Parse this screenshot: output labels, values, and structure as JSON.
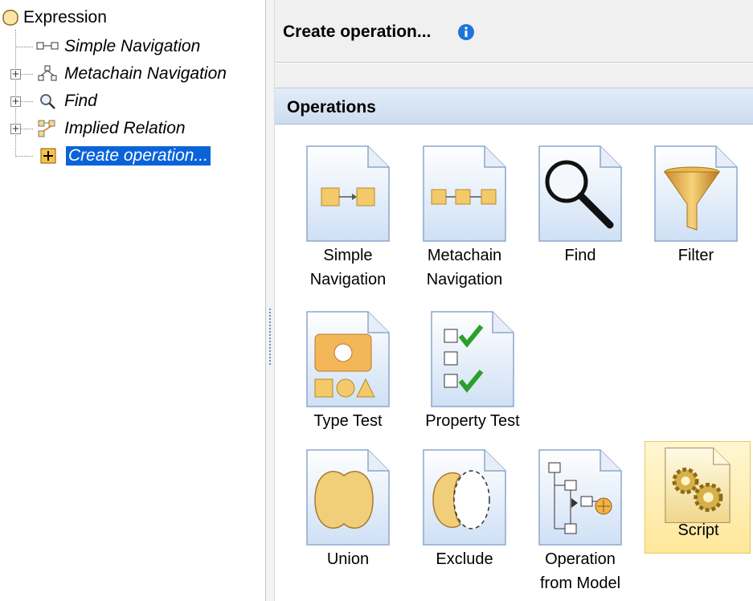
{
  "tree": {
    "root": "Expression",
    "items": [
      {
        "label": "Simple Navigation",
        "icon": "simple-navigation-icon"
      },
      {
        "label": "Metachain Navigation",
        "icon": "metachain-navigation-icon"
      },
      {
        "label": "Find",
        "icon": "magnifier-icon"
      },
      {
        "label": "Implied Relation",
        "icon": "implied-relation-icon"
      },
      {
        "label": "Create operation...",
        "icon": "plus-icon",
        "selected": true
      }
    ]
  },
  "header": {
    "title": "Create operation..."
  },
  "operations": {
    "title": "Operations",
    "items": [
      {
        "line1": "Simple",
        "line2": "Navigation"
      },
      {
        "line1": "Metachain",
        "line2": "Navigation"
      },
      {
        "line1": "Find",
        "line2": ""
      },
      {
        "line1": "Filter",
        "line2": ""
      },
      {
        "line1": "Type Test",
        "line2": ""
      },
      {
        "line1": "Property Test",
        "line2": ""
      },
      {
        "line1": "Union",
        "line2": ""
      },
      {
        "line1": "Exclude",
        "line2": ""
      },
      {
        "line1": "Operation",
        "line2": "from Model"
      },
      {
        "line1": "Script",
        "line2": ""
      }
    ]
  },
  "colors": {
    "selection": "#0a63d9",
    "accent": "#1e74d8",
    "highlight": "#ffe79a"
  }
}
